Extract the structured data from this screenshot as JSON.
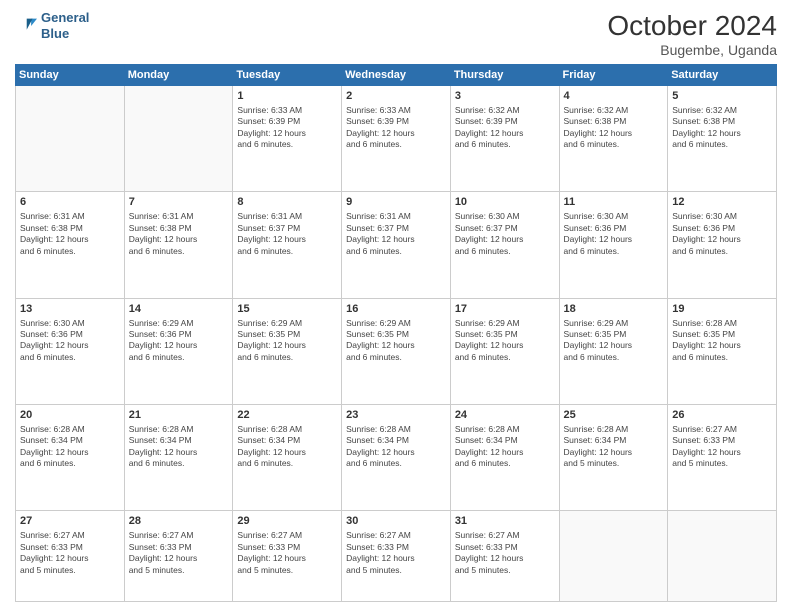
{
  "header": {
    "logo_line1": "General",
    "logo_line2": "Blue",
    "month": "October 2024",
    "location": "Bugembe, Uganda"
  },
  "weekdays": [
    "Sunday",
    "Monday",
    "Tuesday",
    "Wednesday",
    "Thursday",
    "Friday",
    "Saturday"
  ],
  "weeks": [
    [
      {
        "day": "",
        "info": ""
      },
      {
        "day": "",
        "info": ""
      },
      {
        "day": "1",
        "info": "Sunrise: 6:33 AM\nSunset: 6:39 PM\nDaylight: 12 hours\nand 6 minutes."
      },
      {
        "day": "2",
        "info": "Sunrise: 6:33 AM\nSunset: 6:39 PM\nDaylight: 12 hours\nand 6 minutes."
      },
      {
        "day": "3",
        "info": "Sunrise: 6:32 AM\nSunset: 6:39 PM\nDaylight: 12 hours\nand 6 minutes."
      },
      {
        "day": "4",
        "info": "Sunrise: 6:32 AM\nSunset: 6:38 PM\nDaylight: 12 hours\nand 6 minutes."
      },
      {
        "day": "5",
        "info": "Sunrise: 6:32 AM\nSunset: 6:38 PM\nDaylight: 12 hours\nand 6 minutes."
      }
    ],
    [
      {
        "day": "6",
        "info": "Sunrise: 6:31 AM\nSunset: 6:38 PM\nDaylight: 12 hours\nand 6 minutes."
      },
      {
        "day": "7",
        "info": "Sunrise: 6:31 AM\nSunset: 6:38 PM\nDaylight: 12 hours\nand 6 minutes."
      },
      {
        "day": "8",
        "info": "Sunrise: 6:31 AM\nSunset: 6:37 PM\nDaylight: 12 hours\nand 6 minutes."
      },
      {
        "day": "9",
        "info": "Sunrise: 6:31 AM\nSunset: 6:37 PM\nDaylight: 12 hours\nand 6 minutes."
      },
      {
        "day": "10",
        "info": "Sunrise: 6:30 AM\nSunset: 6:37 PM\nDaylight: 12 hours\nand 6 minutes."
      },
      {
        "day": "11",
        "info": "Sunrise: 6:30 AM\nSunset: 6:36 PM\nDaylight: 12 hours\nand 6 minutes."
      },
      {
        "day": "12",
        "info": "Sunrise: 6:30 AM\nSunset: 6:36 PM\nDaylight: 12 hours\nand 6 minutes."
      }
    ],
    [
      {
        "day": "13",
        "info": "Sunrise: 6:30 AM\nSunset: 6:36 PM\nDaylight: 12 hours\nand 6 minutes."
      },
      {
        "day": "14",
        "info": "Sunrise: 6:29 AM\nSunset: 6:36 PM\nDaylight: 12 hours\nand 6 minutes."
      },
      {
        "day": "15",
        "info": "Sunrise: 6:29 AM\nSunset: 6:35 PM\nDaylight: 12 hours\nand 6 minutes."
      },
      {
        "day": "16",
        "info": "Sunrise: 6:29 AM\nSunset: 6:35 PM\nDaylight: 12 hours\nand 6 minutes."
      },
      {
        "day": "17",
        "info": "Sunrise: 6:29 AM\nSunset: 6:35 PM\nDaylight: 12 hours\nand 6 minutes."
      },
      {
        "day": "18",
        "info": "Sunrise: 6:29 AM\nSunset: 6:35 PM\nDaylight: 12 hours\nand 6 minutes."
      },
      {
        "day": "19",
        "info": "Sunrise: 6:28 AM\nSunset: 6:35 PM\nDaylight: 12 hours\nand 6 minutes."
      }
    ],
    [
      {
        "day": "20",
        "info": "Sunrise: 6:28 AM\nSunset: 6:34 PM\nDaylight: 12 hours\nand 6 minutes."
      },
      {
        "day": "21",
        "info": "Sunrise: 6:28 AM\nSunset: 6:34 PM\nDaylight: 12 hours\nand 6 minutes."
      },
      {
        "day": "22",
        "info": "Sunrise: 6:28 AM\nSunset: 6:34 PM\nDaylight: 12 hours\nand 6 minutes."
      },
      {
        "day": "23",
        "info": "Sunrise: 6:28 AM\nSunset: 6:34 PM\nDaylight: 12 hours\nand 6 minutes."
      },
      {
        "day": "24",
        "info": "Sunrise: 6:28 AM\nSunset: 6:34 PM\nDaylight: 12 hours\nand 6 minutes."
      },
      {
        "day": "25",
        "info": "Sunrise: 6:28 AM\nSunset: 6:34 PM\nDaylight: 12 hours\nand 5 minutes."
      },
      {
        "day": "26",
        "info": "Sunrise: 6:27 AM\nSunset: 6:33 PM\nDaylight: 12 hours\nand 5 minutes."
      }
    ],
    [
      {
        "day": "27",
        "info": "Sunrise: 6:27 AM\nSunset: 6:33 PM\nDaylight: 12 hours\nand 5 minutes."
      },
      {
        "day": "28",
        "info": "Sunrise: 6:27 AM\nSunset: 6:33 PM\nDaylight: 12 hours\nand 5 minutes."
      },
      {
        "day": "29",
        "info": "Sunrise: 6:27 AM\nSunset: 6:33 PM\nDaylight: 12 hours\nand 5 minutes."
      },
      {
        "day": "30",
        "info": "Sunrise: 6:27 AM\nSunset: 6:33 PM\nDaylight: 12 hours\nand 5 minutes."
      },
      {
        "day": "31",
        "info": "Sunrise: 6:27 AM\nSunset: 6:33 PM\nDaylight: 12 hours\nand 5 minutes."
      },
      {
        "day": "",
        "info": ""
      },
      {
        "day": "",
        "info": ""
      }
    ]
  ]
}
